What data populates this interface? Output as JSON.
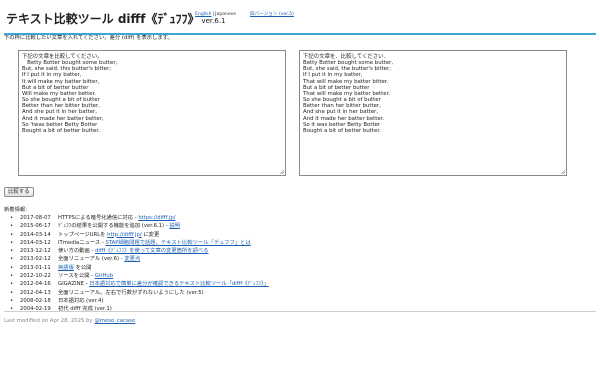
{
  "header": {
    "title": "テキスト比較ツール difff《ﾃﾞｭﾌﾌ》",
    "version": "ver.6.1",
    "lang_english": "English",
    "lang_separator": "|",
    "lang_japanese": "Japanese",
    "old_version_link": "旧バージョン (ver.5)"
  },
  "instruction": "下の枠に比較したい文章を入れてください。差分 (diff) を表示します。",
  "left_text": "下記の文章を比較してください。\n   Betty Botter bought some butter,\nBut, she said, this butter's bitter;\nIf I put it in my batter,\nIt will make my batter bitter,\nBut a bit of better butter\nWill make my batter better.\nSo she bought a bit of butter\nBetter than her bitter butter,\nAnd she put it in her batter,\nAnd it made her batter better,\nSo 'twas better Betty Botter\nBought a bit of better butter.",
  "right_text": "下記の文章を．比較してください．\nBetty Botter bought some butter,\nBut, she said, the butter's bitter;\nIf I put it in my batter,\nThat will make my batter bitter.\nBut a bit of better butter\nThat will make my batter better.\nSo she bought a bit of butter\nBetter than her bitter butter,\nAnd she put it in her batter,\nAnd it made her batter better.\nSo it was better Betty Botter\nBought a bit of better butter.",
  "compare_button": "比較する",
  "news_title": "新着情報：",
  "bullet": "•",
  "news": [
    {
      "date": "2017-08-07",
      "text": "HTTPSによる暗号化通信に対応 - ",
      "link": "https://difff.jp/",
      "after": ""
    },
    {
      "date": "2015-06-17",
      "text": "ﾃﾞｭﾌﾌの結果を公開する機能を追加 (ver.6.1) - ",
      "link": "説明",
      "after": ""
    },
    {
      "date": "2014-03-14",
      "text": "トップページURLを ",
      "link": "http://difff.jp/",
      "after": " に変更"
    },
    {
      "date": "2014-03-12",
      "text": "ITmediaニュース - ",
      "link": "STAP細胞問題で話題、テキスト比較ツール「デュフフ」とは",
      "after": ""
    },
    {
      "date": "2013-12-12",
      "text": "使い方の動画 - ",
      "link": "difff《ﾃﾞｭﾌﾌ》を使って文章の変更箇所を調べる",
      "after": ""
    },
    {
      "date": "2013-02-12",
      "text": "全面リニューアル (ver.6) - ",
      "link": "変更点",
      "after": ""
    },
    {
      "date": "2013-01-11",
      "text": "",
      "link": "英語版",
      "after": " を公開"
    },
    {
      "date": "2012-10-22",
      "text": "ソースを公開 - ",
      "link": "GitHub",
      "after": ""
    },
    {
      "date": "2012-04-16",
      "text": "GIGAZINE - ",
      "link": "日本語対応で簡単に差分が確認できるテキスト比較ツール「difff《ﾃﾞｭﾌﾌ》」",
      "after": ""
    },
    {
      "date": "2012-04-13",
      "text": "全面リニューアル。左右で行数がずれないようにした (ver.5)",
      "link": "",
      "after": ""
    },
    {
      "date": "2008-02-18",
      "text": "日本語対応 (ver.4)",
      "link": "",
      "after": ""
    },
    {
      "date": "2004-02-19",
      "text": "初代 difff 完成 (ver.1)",
      "link": "",
      "after": ""
    }
  ],
  "footer": {
    "text": "Last modified on Apr 28, 2025 by",
    "author": "@meso_cacase"
  }
}
